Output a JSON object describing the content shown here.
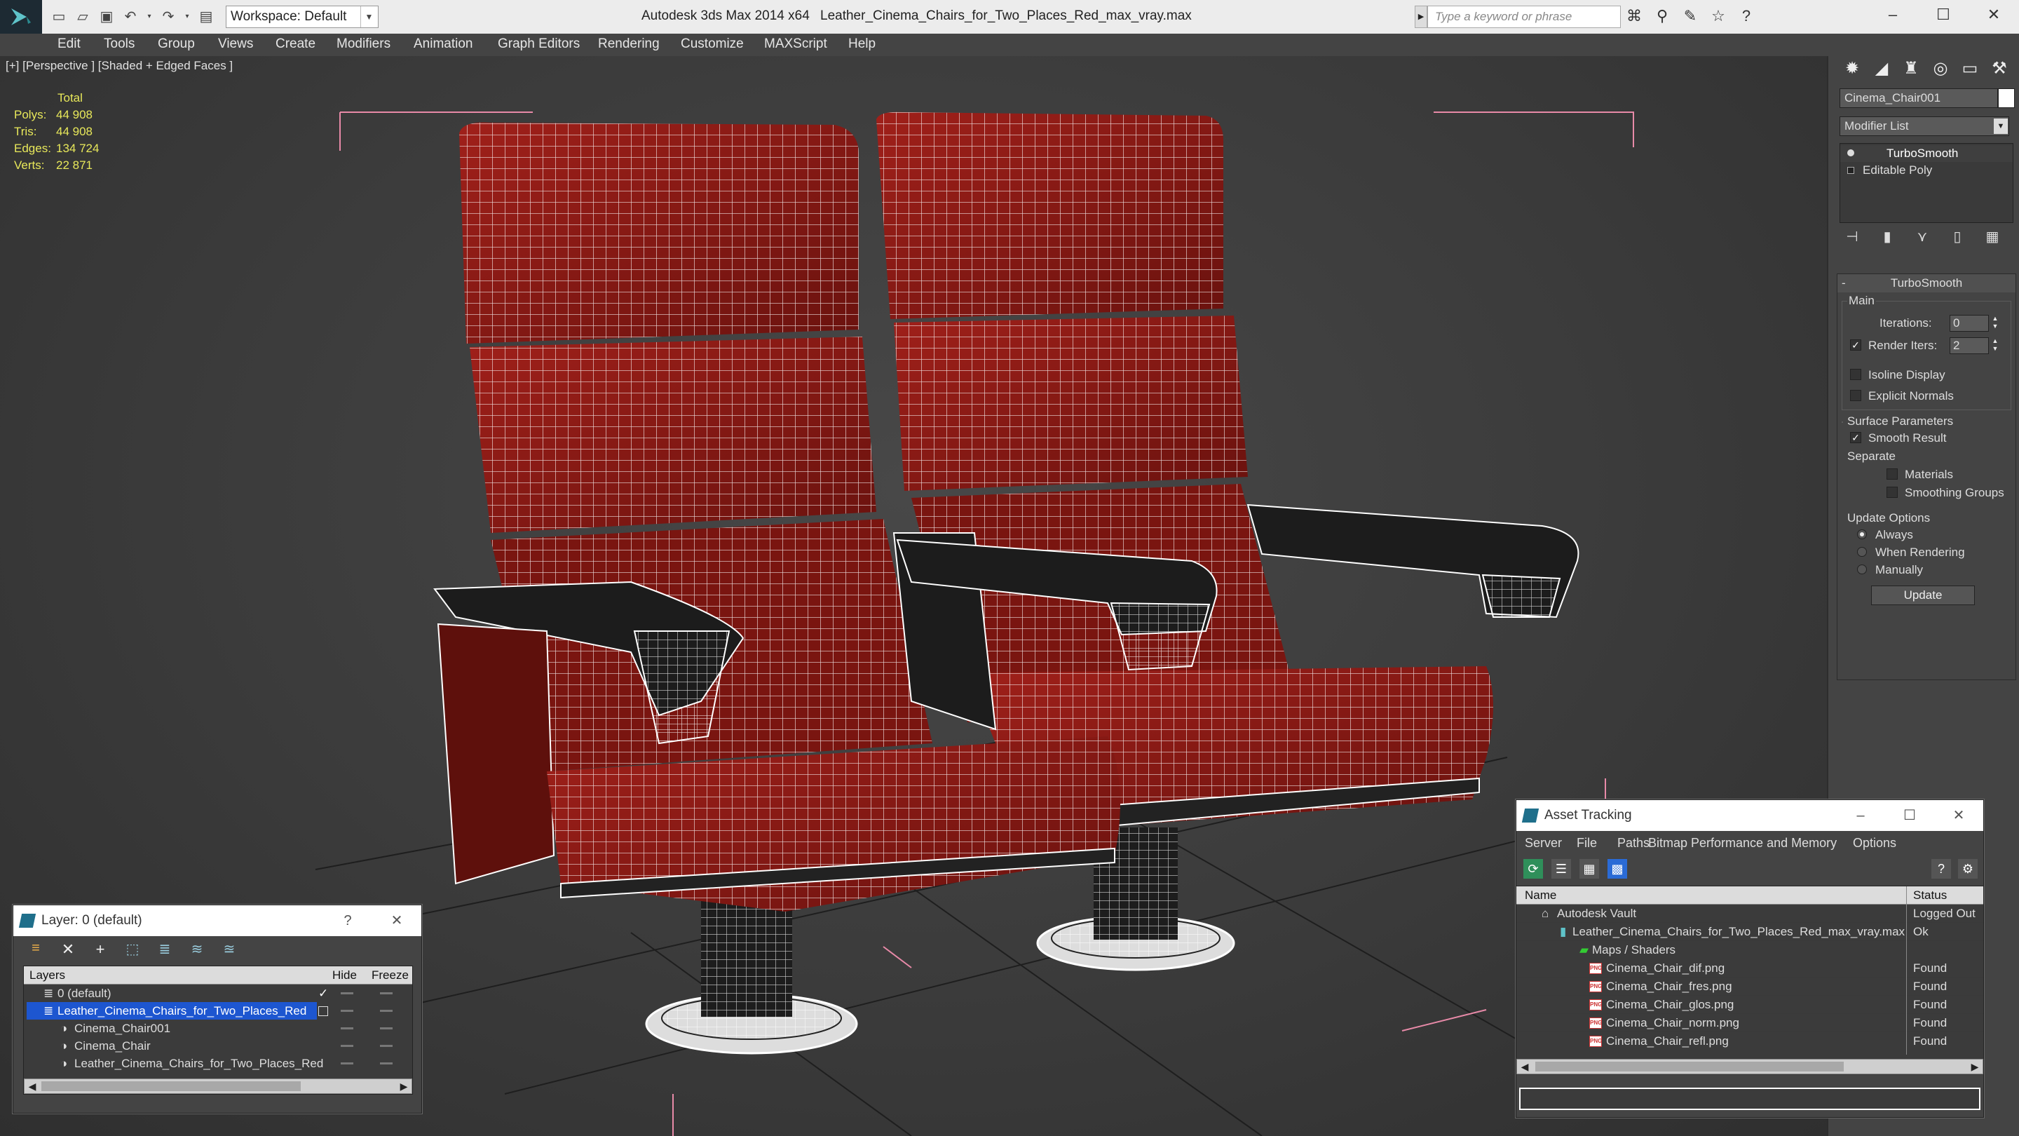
{
  "titlebar": {
    "workspace": "Workspace: Default",
    "app_title": "Autodesk 3ds Max  2014 x64",
    "file_title": "Leather_Cinema_Chairs_for_Two_Places_Red_max_vray.max",
    "search_placeholder": "Type a keyword or phrase",
    "help_glyph": "?"
  },
  "menu": [
    "Edit",
    "Tools",
    "Group",
    "Views",
    "Create",
    "Modifiers",
    "Animation",
    "Graph Editors",
    "Rendering",
    "Customize",
    "MAXScript",
    "Help"
  ],
  "viewport": {
    "label": "[+] [Perspective ] [Shaded + Edged Faces ]",
    "stats": {
      "header": "Total",
      "rows": [
        {
          "label": "Polys:",
          "value": "44 908"
        },
        {
          "label": "Tris:",
          "value": "44 908"
        },
        {
          "label": "Edges:",
          "value": "134 724"
        },
        {
          "label": "Verts:",
          "value": "22 871"
        }
      ]
    }
  },
  "command_panel": {
    "object_name": "Cinema_Chair001",
    "modifier_list": "Modifier List",
    "stack": [
      "TurboSmooth",
      "Editable Poly"
    ],
    "rollout": {
      "title": "TurboSmooth",
      "main_label": "Main",
      "iterations_label": "Iterations:",
      "iterations_value": "0",
      "render_iters_label": "Render Iters:",
      "render_iters_value": "2",
      "isoline_label": "Isoline Display",
      "explicit_label": "Explicit Normals",
      "surface_label": "Surface Parameters",
      "smooth_label": "Smooth Result",
      "separate_label": "Separate",
      "materials_label": "Materials",
      "smoothing_groups_label": "Smoothing Groups",
      "update_options_label": "Update Options",
      "always_label": "Always",
      "when_rendering_label": "When Rendering",
      "manually_label": "Manually",
      "update_button": "Update"
    }
  },
  "layer_window": {
    "title": "Layer: 0 (default)",
    "help": "?",
    "columns": [
      "Layers",
      "Hide",
      "Freeze"
    ],
    "rows": [
      {
        "name": "0 (default)",
        "indent": 1,
        "selected": false
      },
      {
        "name": "Leather_Cinema_Chairs_for_Two_Places_Red",
        "indent": 1,
        "selected": true
      },
      {
        "name": "Cinema_Chair001",
        "indent": 2,
        "selected": false
      },
      {
        "name": "Cinema_Chair",
        "indent": 2,
        "selected": false
      },
      {
        "name": "Leather_Cinema_Chairs_for_Two_Places_Red",
        "indent": 2,
        "selected": false
      }
    ]
  },
  "asset_window": {
    "title": "Asset Tracking",
    "menu": [
      "Server",
      "File",
      "Paths",
      "Bitmap Performance and Memory",
      "Options"
    ],
    "columns": [
      "Name",
      "Status"
    ],
    "rows": [
      {
        "name": "Autodesk Vault",
        "status": "Logged Out",
        "indent": 0
      },
      {
        "name": "Leather_Cinema_Chairs_for_Two_Places_Red_max_vray.max",
        "status": "Ok",
        "indent": 1
      },
      {
        "name": "Maps / Shaders",
        "status": "",
        "indent": 2
      },
      {
        "name": "Cinema_Chair_dif.png",
        "status": "Found",
        "indent": 3
      },
      {
        "name": "Cinema_Chair_fres.png",
        "status": "Found",
        "indent": 3
      },
      {
        "name": "Cinema_Chair_glos.png",
        "status": "Found",
        "indent": 3
      },
      {
        "name": "Cinema_Chair_norm.png",
        "status": "Found",
        "indent": 3
      },
      {
        "name": "Cinema_Chair_refl.png",
        "status": "Found",
        "indent": 3
      }
    ]
  },
  "colors": {
    "seat_red": "#8e1a14",
    "wire": "#ffffff",
    "frame": "#1c1c1c",
    "selection": "#1d56d0",
    "stats_yellow": "#e8e85a"
  }
}
